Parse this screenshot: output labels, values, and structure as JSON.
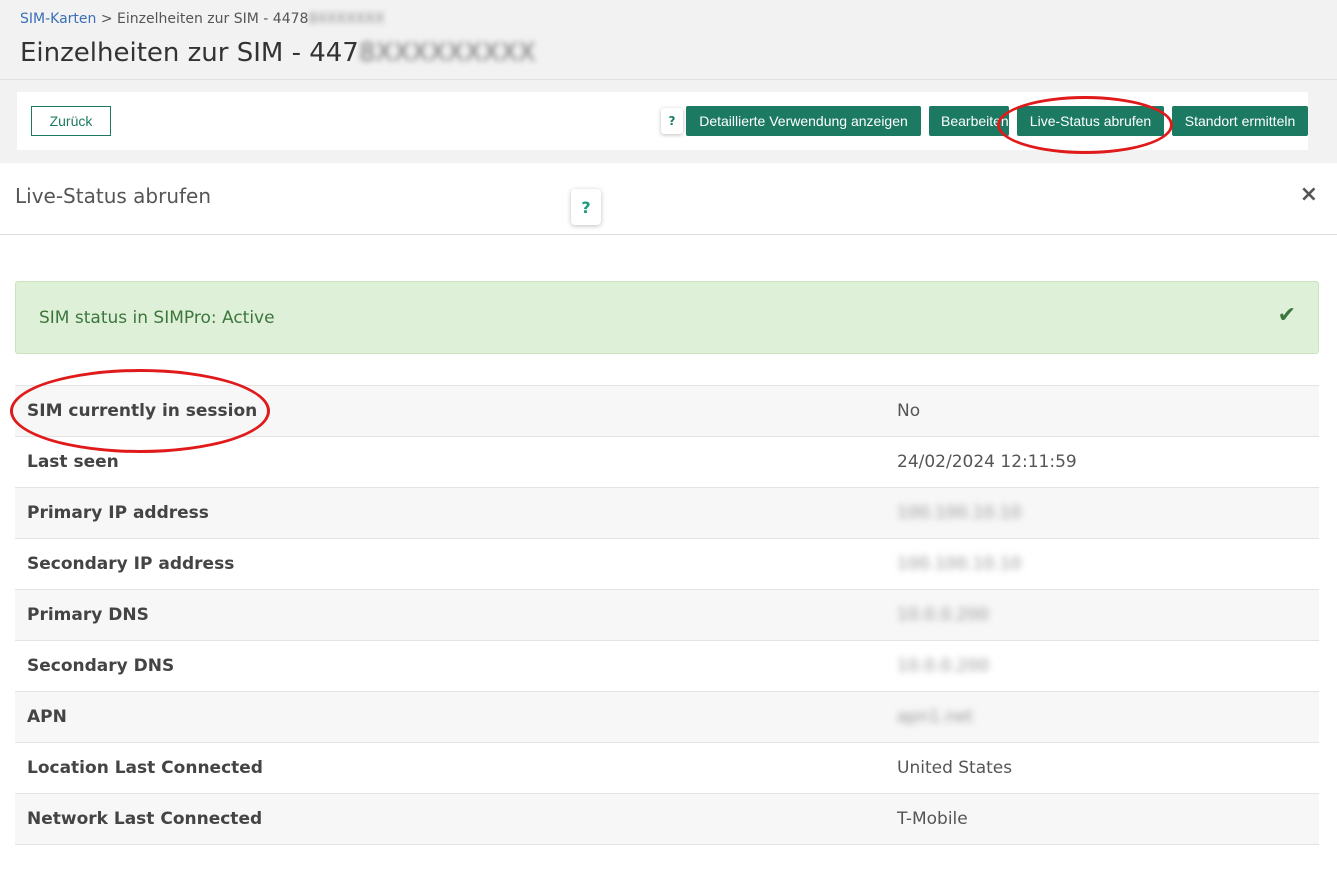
{
  "breadcrumb": {
    "parent": "SIM-Karten",
    "separator": ">",
    "current": "Einzelheiten zur SIM - 4478",
    "current_redacted": "8XXXXXXX"
  },
  "page": {
    "title": "Einzelheiten zur SIM - 447",
    "title_redacted": "8XXXXXXXXX"
  },
  "toolbar": {
    "back_label": "Zurück",
    "help_label": "?",
    "usage_label": "Detaillierte Verwendung anzeigen",
    "edit_label": "Bearbeiten",
    "live_status_label": "Live-Status abrufen",
    "locate_label": "Standort ermitteln"
  },
  "modal": {
    "title": "Live-Status abrufen",
    "help_label": "?",
    "close_label": "×",
    "alert_text": "SIM status in SIMPro: Active",
    "alert_icon": "check-icon",
    "rows": [
      {
        "label": "SIM currently in session",
        "value": "No"
      },
      {
        "label": "Last seen",
        "value": "24/02/2024 12:11:59"
      },
      {
        "label": "Primary IP address",
        "value": "100.100.10.10"
      },
      {
        "label": "Secondary IP address",
        "value": "100.100.10.10"
      },
      {
        "label": "Primary DNS",
        "value": "10.0.0.200"
      },
      {
        "label": "Secondary DNS",
        "value": "10.0.0.200"
      },
      {
        "label": "APN",
        "value": "apn1.net"
      },
      {
        "label": "Location Last Connected",
        "value": "United States"
      },
      {
        "label": "Network Last Connected",
        "value": "T-Mobile"
      }
    ]
  },
  "colors": {
    "primary_green": "#1c7a63",
    "alert_bg": "#dff0d8",
    "alert_text": "#3c763d",
    "annotation_red": "#e01a1a"
  }
}
